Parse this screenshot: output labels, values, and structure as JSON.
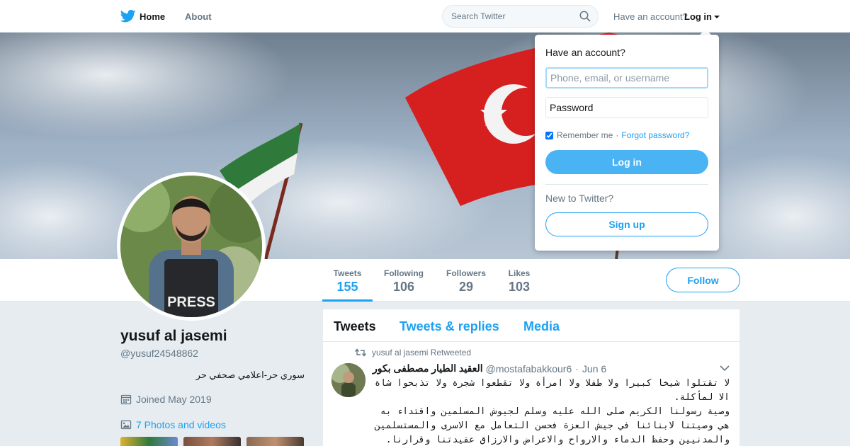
{
  "nav": {
    "logo_icon": "twitter-bird-icon",
    "home_label": "Home",
    "about_label": "About",
    "search_placeholder": "Search Twitter",
    "have_account_label": "Have an account?",
    "login_label": "Log in"
  },
  "profile": {
    "name": "yusuf al jasemi",
    "handle": "@yusuf24548862",
    "bio": "سوري حر-اعلامي صحفي حر",
    "joined": "Joined May 2019",
    "photos_label": "7 Photos and videos",
    "follow_label": "Follow"
  },
  "stats": [
    {
      "label": "Tweets",
      "value": "155"
    },
    {
      "label": "Following",
      "value": "106"
    },
    {
      "label": "Followers",
      "value": "29"
    },
    {
      "label": "Likes",
      "value": "103"
    }
  ],
  "timeline": {
    "tabs": [
      "Tweets",
      "Tweets & replies",
      "Media"
    ],
    "tweet": {
      "retweet_label": "yusuf al jasemi Retweeted",
      "fullname": "العقيد الطيار مصطفى بكور",
      "username": "@mostafabakkour6",
      "time": "Jun 6",
      "text_lines": [
        "لا تقتلوا شيخا كبيرا ولا طفلا ولا امرأة ولا تقطعوا شجرة ولا تذبحوا شاة الا لمأكلة.",
        "وصية رسولنا الكريم صلى الله عليه وسلم لجيوش المسلمين واقتداء به هي وصيتنا لابنائنا في جيش العزة فحسن التعامل مع الاسرى والمستسلمين والمدنيين وحفظ الدماء والارواح والاعراض والارزاق عقيدتنا وقرارنا."
      ]
    }
  },
  "login_dropdown": {
    "title": "Have an account?",
    "username_placeholder": "Phone, email, or username",
    "password_placeholder": "Password",
    "remember_label": "Remember me",
    "separator": "·",
    "forgot_label": "Forgot password?",
    "login_button": "Log in",
    "new_label": "New to Twitter?",
    "signup_button": "Sign up"
  },
  "colors": {
    "brand": "#1da1f2",
    "background": "#e6ecf0"
  }
}
